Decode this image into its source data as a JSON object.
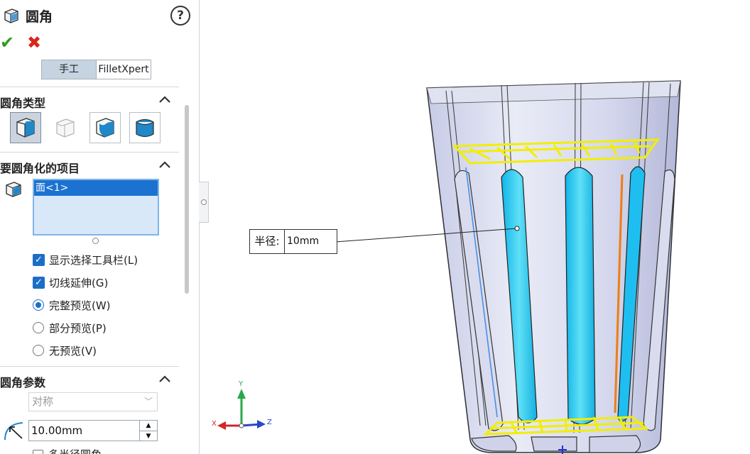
{
  "panel": {
    "title": "圆角",
    "help": "?",
    "modes": {
      "manual": "手工",
      "expert": "FilletXpert"
    },
    "fillet_type": {
      "header": "圆角类型"
    },
    "items_to_fillet": {
      "header": "要圆角化的项目",
      "selected": "面<1>"
    },
    "options": {
      "show_toolbar": "显示选择工具栏(L)",
      "tangent_propagation": "切线延伸(G)",
      "full_preview": "完整预览(W)",
      "partial_preview": "部分预览(P)",
      "no_preview": "无预览(V)"
    },
    "fillet_params": {
      "header": "圆角参数",
      "method": "对称",
      "radius": "10.00mm",
      "multi_radius": "多半径圆角"
    }
  },
  "viewport": {
    "callout": {
      "label": "半径:",
      "value": "10mm"
    },
    "axes": {
      "x": "X",
      "y": "Y",
      "z": "Z"
    }
  },
  "colors": {
    "accent": "#1b6ec8",
    "preview_yellow": "#f2ee00",
    "face_cyan": "#27c8ee",
    "edge_orange": "#f07d10"
  }
}
